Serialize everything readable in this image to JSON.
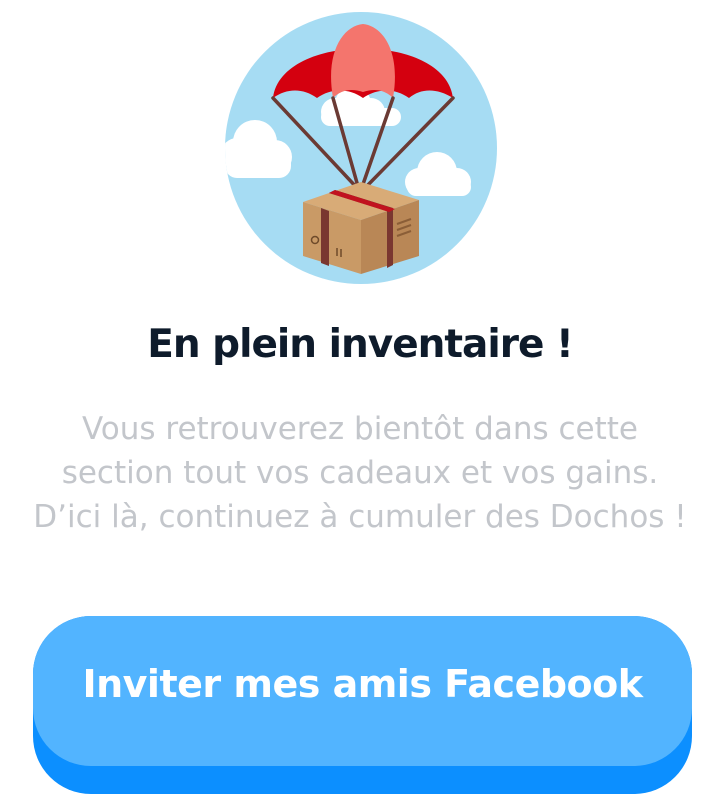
{
  "illustration": {
    "icon": "parachute-box-icon",
    "colors": {
      "sky": "#a6dcf3",
      "canopy": "#d4000f",
      "canopy_highlight": "#f4756d",
      "box": "#c99a66",
      "strap": "#6b3a34"
    }
  },
  "empty_state": {
    "title": "En plein inventaire !",
    "message": "Vous retrouverez bientôt dans cette section tout vos cadeaux et vos gains. D’ici là, continuez à cumuler des Dochos !"
  },
  "cta": {
    "label": "Inviter mes amis Facebook",
    "color": "#52b4ff",
    "shadow_color": "#0c8fff"
  }
}
